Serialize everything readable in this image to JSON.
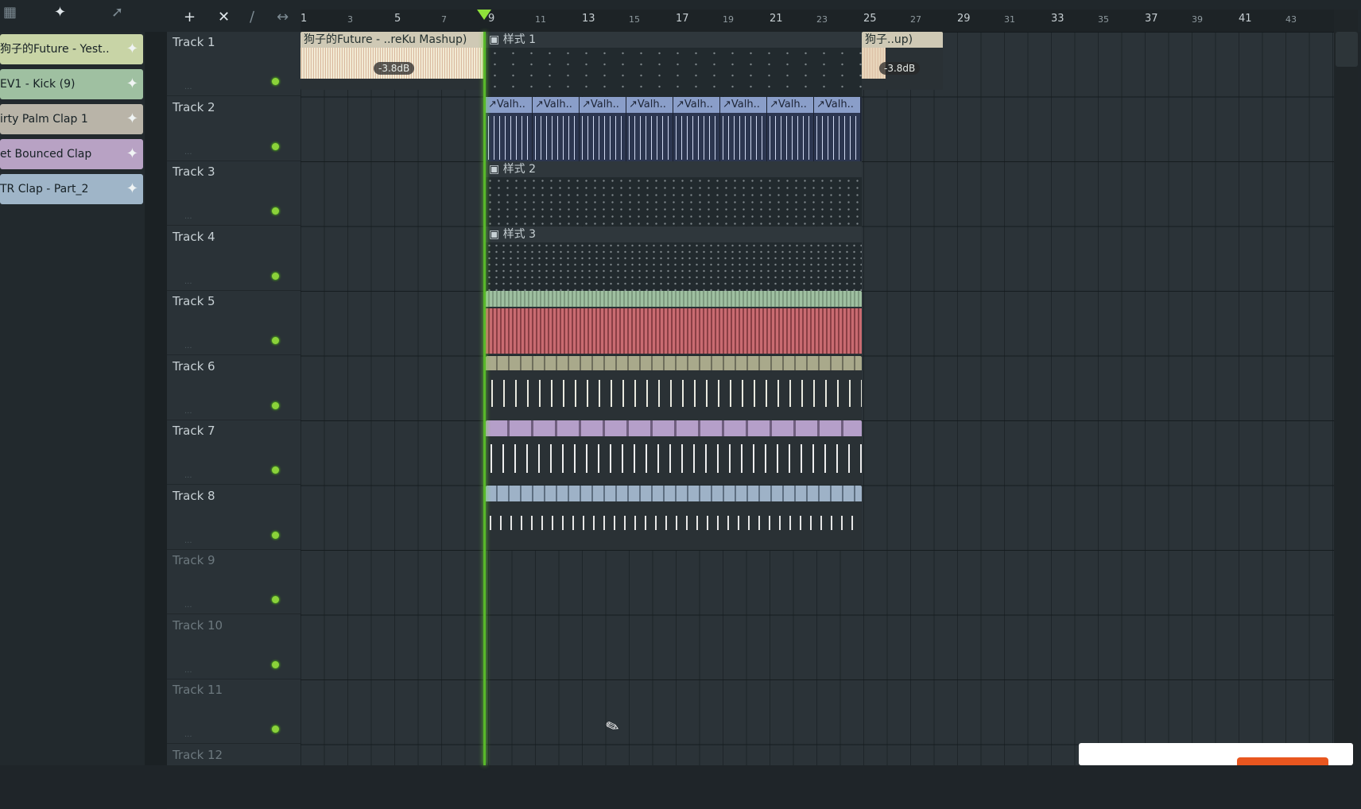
{
  "toolbar": {
    "icons": [
      "piano-roll-icon",
      "channel-rack-icon",
      "link-icon",
      "add-icon",
      "delete-icon"
    ]
  },
  "sidebar": {
    "clips": [
      {
        "name": "狗子的Future - Yest..",
        "color": "#c8d4a6"
      },
      {
        "name": "EV1 - Kick (9)",
        "color": "#9fc0a1"
      },
      {
        "name": "irty Palm Clap 1",
        "color": "#b9b4a8"
      },
      {
        "name": "et Bounced Clap",
        "color": "#b8a2c4"
      },
      {
        "name": "TR Clap - Part_2",
        "color": "#9fb5c8"
      }
    ]
  },
  "tracks": [
    {
      "label": "Track 1"
    },
    {
      "label": "Track 2"
    },
    {
      "label": "Track 3"
    },
    {
      "label": "Track 4"
    },
    {
      "label": "Track 5"
    },
    {
      "label": "Track 6"
    },
    {
      "label": "Track 7"
    },
    {
      "label": "Track 8"
    },
    {
      "label": "Track 9"
    },
    {
      "label": "Track 10"
    },
    {
      "label": "Track 11"
    },
    {
      "label": "Track 12"
    }
  ],
  "timeline": {
    "major_ticks": [
      "1",
      "5",
      "9",
      "13",
      "17",
      "21",
      "25",
      "29",
      "33",
      "37",
      "41"
    ],
    "minor_ticks": [
      "3",
      "7",
      "11",
      "15",
      "19",
      "23",
      "27",
      "31",
      "35",
      "39",
      "43"
    ],
    "playhead_bar": 9
  },
  "clips": {
    "track1_audio_a": {
      "title": "狗子的Future - ..reKu Mashup)",
      "gain": "-3.8dB"
    },
    "track1_pattern": {
      "title": "样式 1"
    },
    "track1_audio_b": {
      "title": "狗子..up)",
      "gain": "-3.8dB"
    },
    "track2_automation": {
      "title": "Valh.."
    },
    "track3_pattern": {
      "title": "样式 2"
    },
    "track4_pattern": {
      "title": "样式 3"
    }
  },
  "colors": {
    "playhead": "#58b82a",
    "audio_clip": "#e8dcc0",
    "automation": "#8a9ec9",
    "kick": "#c96b71",
    "clap1": "#a9a98b",
    "clap2": "#b59fc9",
    "clap3": "#9eb2c7",
    "popup_button": "#e8561f"
  }
}
